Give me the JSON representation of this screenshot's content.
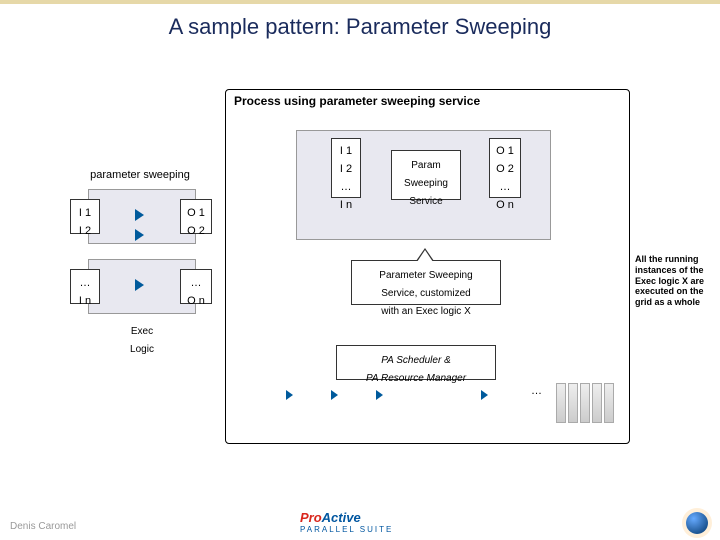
{
  "title": "A sample pattern: Parameter Sweeping",
  "process_title": "Process using parameter sweeping service",
  "left_panel": {
    "label": "parameter sweeping",
    "inputs_top": "I 1\nI 2",
    "inputs_bottom": "…\nI n",
    "outputs_top": "O 1\nO 2",
    "outputs_bottom": "…\nO n",
    "exec_label": "Exec\nLogic"
  },
  "inner": {
    "inputs_top": "I 1\nI 2",
    "inputs_bottom": "…\nI n",
    "outputs_top": "O 1\nO 2",
    "outputs_bottom": "…\nO n",
    "service_label": "Param\nSweeping\nService",
    "callout": "Parameter Sweeping\nService, customized\nwith an Exec logic X",
    "scheduler": "PA Scheduler &\nPA Resource Manager",
    "ellipsis": "…"
  },
  "note": "All the running instances of the Exec logic X are executed on the grid as a whole",
  "footer": {
    "author": "Denis Caromel",
    "logo_pro": "Pro",
    "logo_active": "Active",
    "logo_sub": "PARALLEL SUITE"
  }
}
